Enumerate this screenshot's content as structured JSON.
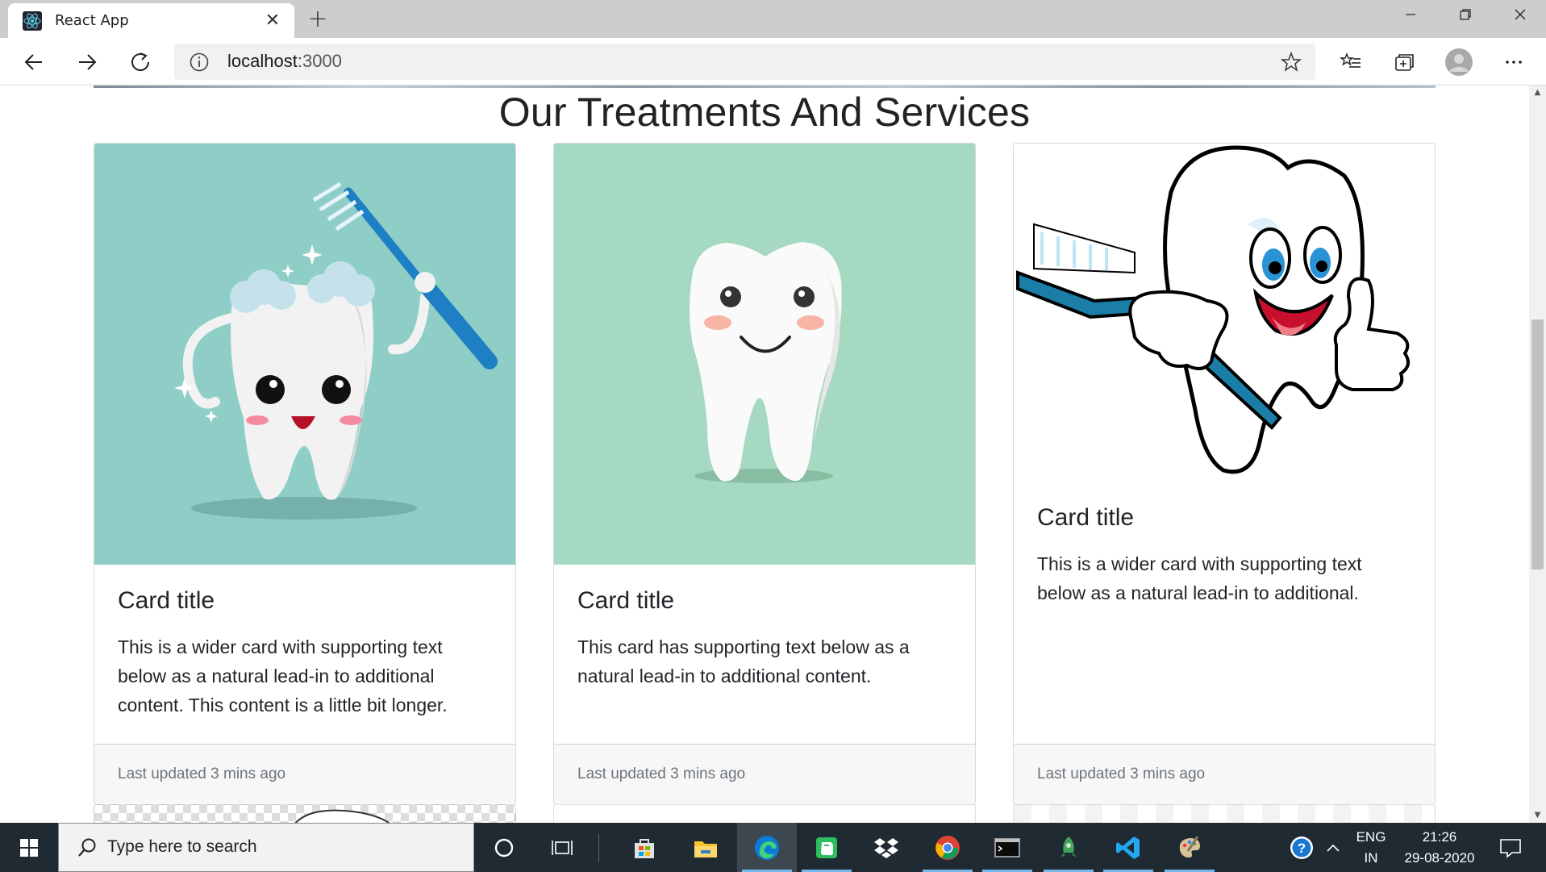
{
  "browser": {
    "tab_title": "React App",
    "address_host": "localhost",
    "address_port": ":3000"
  },
  "page": {
    "section_title": "Our Treatments And Services",
    "cards": [
      {
        "title": "Card title",
        "text": "This is a wider card with supporting text below as a natural lead-in to additional content. This content is a little bit longer.",
        "footer": "Last updated 3 mins ago",
        "image_bg": "#8fcec7"
      },
      {
        "title": "Card title",
        "text": "This card has supporting text below as a natural lead-in to additional content.",
        "footer": "Last updated 3 mins ago",
        "image_bg": "#a6d9c1"
      },
      {
        "title": "Card title",
        "text": "This is a wider card with supporting text below as a natural lead-in to additional.",
        "footer": "Last updated 3 mins ago",
        "image_bg": "#ffffff"
      }
    ]
  },
  "taskbar": {
    "search_placeholder": "Type here to search",
    "lang_top": "ENG",
    "lang_bottom": "IN",
    "time": "21:26",
    "date": "29-08-2020"
  },
  "colors": {
    "taskbar_bg": "#1f2a33",
    "accent": "#76b9ed",
    "toothbrush_blue": "#1f7fc4"
  }
}
